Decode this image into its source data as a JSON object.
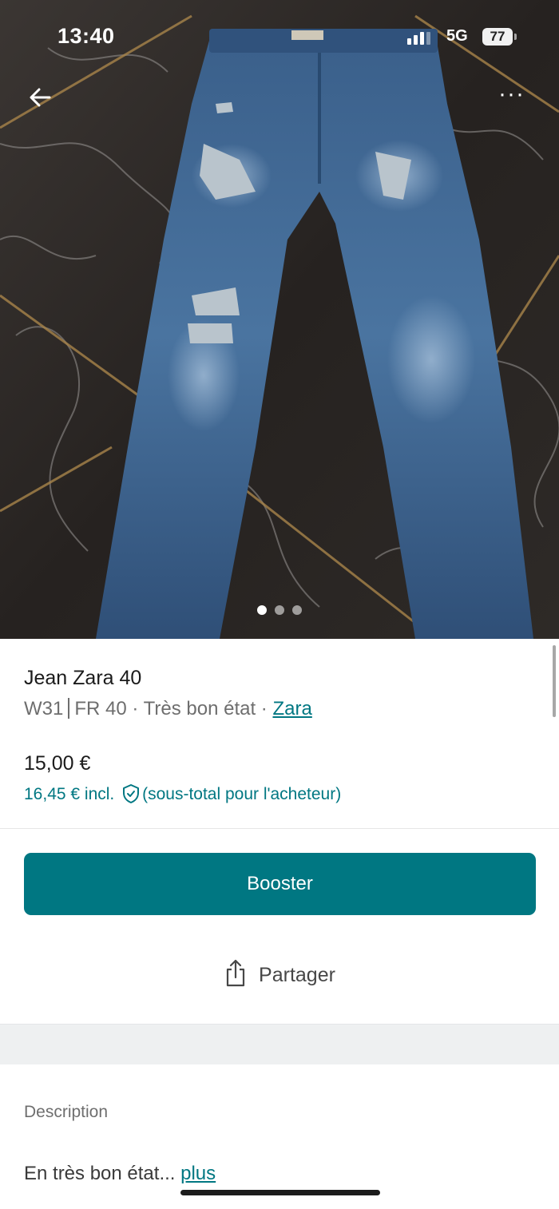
{
  "status_bar": {
    "time": "13:40",
    "network": "5G",
    "battery": "77"
  },
  "listing": {
    "title": "Jean Zara 40",
    "size_w": "W31",
    "size_fr": "FR 40",
    "condition_text": "· Très bon état ·",
    "brand": "Zara",
    "price": "15,00 €",
    "price_incl": "16,45 € incl.",
    "price_incl_note": "(sous-total pour l'acheteur)"
  },
  "photo_pager": {
    "count": 3,
    "active": 1
  },
  "actions": {
    "booster_label": "Booster",
    "share_label": "Partager"
  },
  "description": {
    "label": "Description",
    "text": "En très bon état...",
    "more_link": "plus"
  },
  "colors": {
    "accent": "#007782",
    "text": "#1b1b1b",
    "muted": "#6e6e6e"
  },
  "icons": [
    "back-arrow-icon",
    "more-dots-icon",
    "shield-check-icon",
    "share-icon"
  ]
}
